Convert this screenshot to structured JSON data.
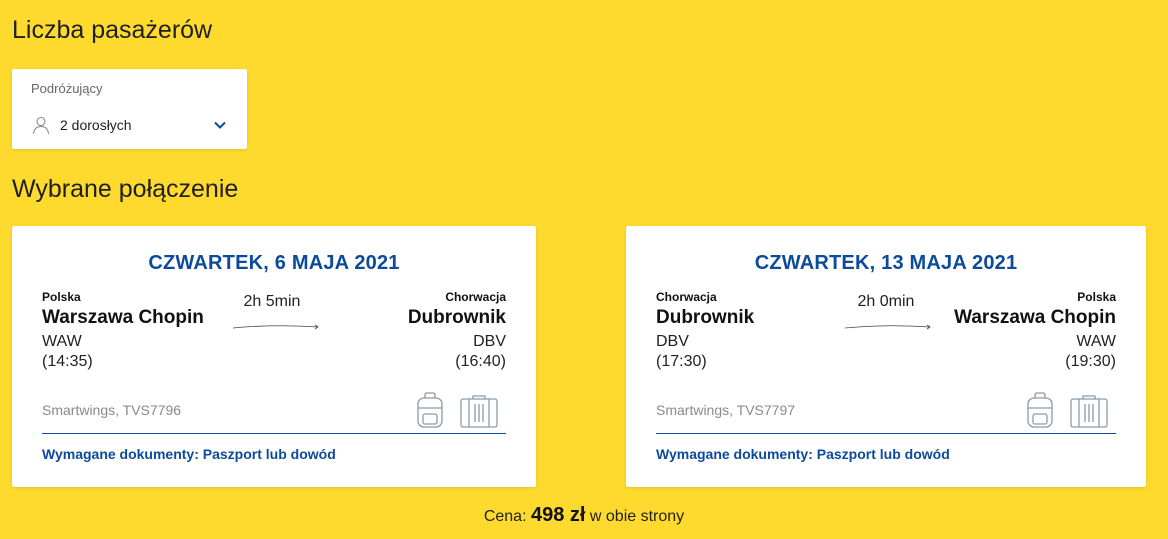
{
  "passengers": {
    "title": "Liczba pasażerów",
    "label": "Podróżujący",
    "value": "2 dorosłych",
    "icon": "person-icon"
  },
  "connection": {
    "title": "Wybrane połączenie",
    "flights": [
      {
        "date": "CZWARTEK, 6 MAJA 2021",
        "from": {
          "country": "Polska",
          "airport": "Warszawa Chopin",
          "code": "WAW",
          "time": "(14:35)"
        },
        "to": {
          "country": "Chorwacja",
          "airport": "Dubrownik",
          "code": "DBV",
          "time": "(16:40)"
        },
        "duration": "2h 5min",
        "airline": "Smartwings, TVS7796",
        "documents": "Wymagane dokumenty: Paszport lub dowód"
      },
      {
        "date": "CZWARTEK, 13 MAJA 2021",
        "from": {
          "country": "Chorwacja",
          "airport": "Dubrownik",
          "code": "DBV",
          "time": "(17:30)"
        },
        "to": {
          "country": "Polska",
          "airport": "Warszawa Chopin",
          "code": "WAW",
          "time": "(19:30)"
        },
        "duration": "2h 0min",
        "airline": "Smartwings, TVS7797",
        "documents": "Wymagane dokumenty: Paszport lub dowód"
      }
    ]
  },
  "price": {
    "prefix": "Cena:",
    "amount": "498 zł",
    "suffix": "w obie strony"
  },
  "colors": {
    "background": "#ffda2e",
    "accent": "#0b4a9c"
  }
}
